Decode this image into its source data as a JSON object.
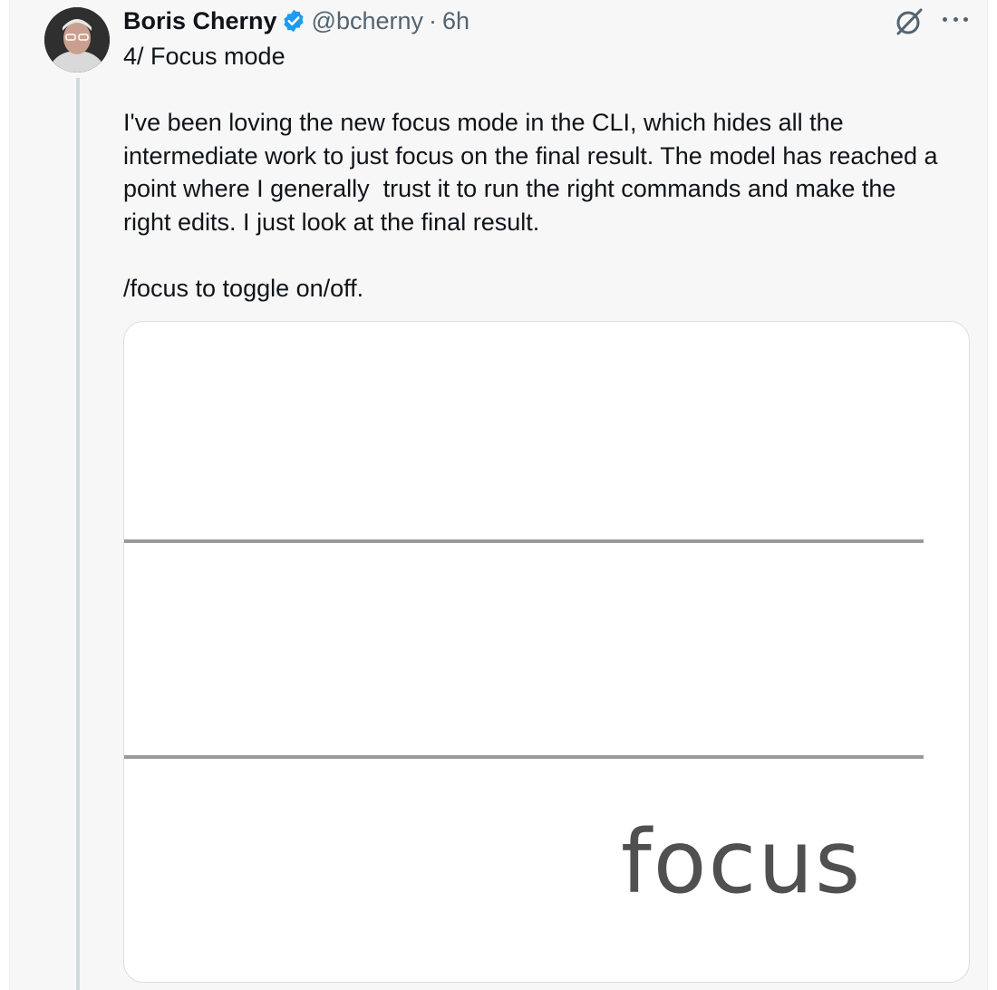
{
  "author": {
    "name": "Boris Cherny",
    "handle": "@bcherny",
    "separator": "·",
    "time": "6h"
  },
  "tweet": {
    "lines": [
      "4/ Focus mode",
      "",
      "I've been loving the new focus mode in the CLI, which hides all the",
      "intermediate work to just focus on the final result. The model has reached a",
      "point where I generally  trust it to run the right commands and make the",
      "right edits. I just look at the final result.",
      "",
      "/focus to toggle on/off."
    ]
  },
  "media": {
    "focus_text": "focus"
  },
  "colors": {
    "verified_badge": "#1d9bf0",
    "secondary_text": "#536471",
    "thread_line": "#cfd9de"
  },
  "icons": {
    "verified": "verified-badge-icon",
    "grok": "grok-icon",
    "more": "more-options-icon"
  }
}
